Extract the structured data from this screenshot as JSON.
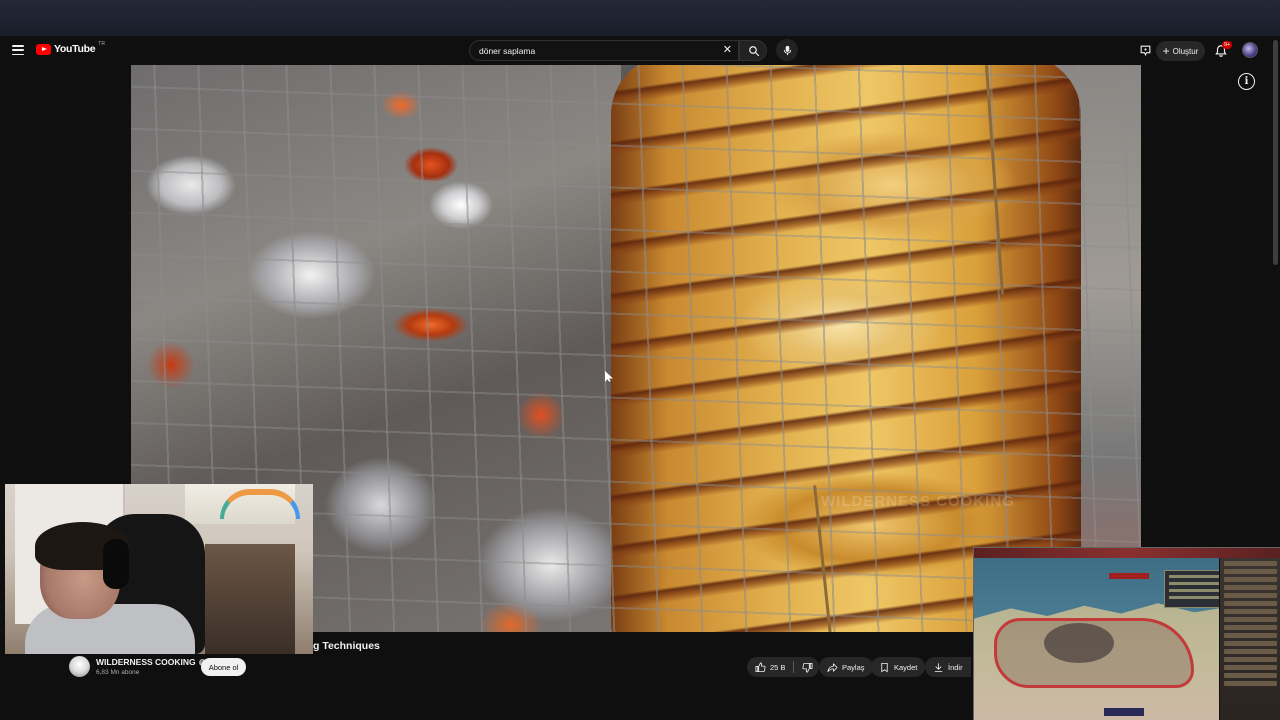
{
  "header": {
    "logo_text": "YouTube",
    "logo_country": "TR",
    "search_value": "döner saplama",
    "create_label": "Oluştur",
    "notification_count": "9+"
  },
  "video": {
    "title": "g Techniques",
    "watermark": "WILDERNESS COOKING"
  },
  "channel": {
    "name": "WILDERNESS COOKING",
    "subscribers": "6,83 Mn abone",
    "subscribe_label": "Abone ol"
  },
  "actions": {
    "like_count": "25 B",
    "share_label": "Paylaş",
    "save_label": "Kaydet",
    "download_label": "İndir"
  },
  "icons": {
    "menu": "hamburger-menu-icon",
    "search": "search-icon",
    "clear": "close-icon",
    "mic": "microphone-icon",
    "cast": "cast-icon",
    "bell": "bell-icon",
    "info": "info-icon",
    "like": "thumbs-up-icon",
    "dislike": "thumbs-down-icon",
    "share": "share-icon",
    "save": "save-playlist-icon",
    "download": "download-icon"
  },
  "colors": {
    "brand_red": "#ff0000",
    "background": "#0f0f0f",
    "pill_bg": "#272727"
  }
}
